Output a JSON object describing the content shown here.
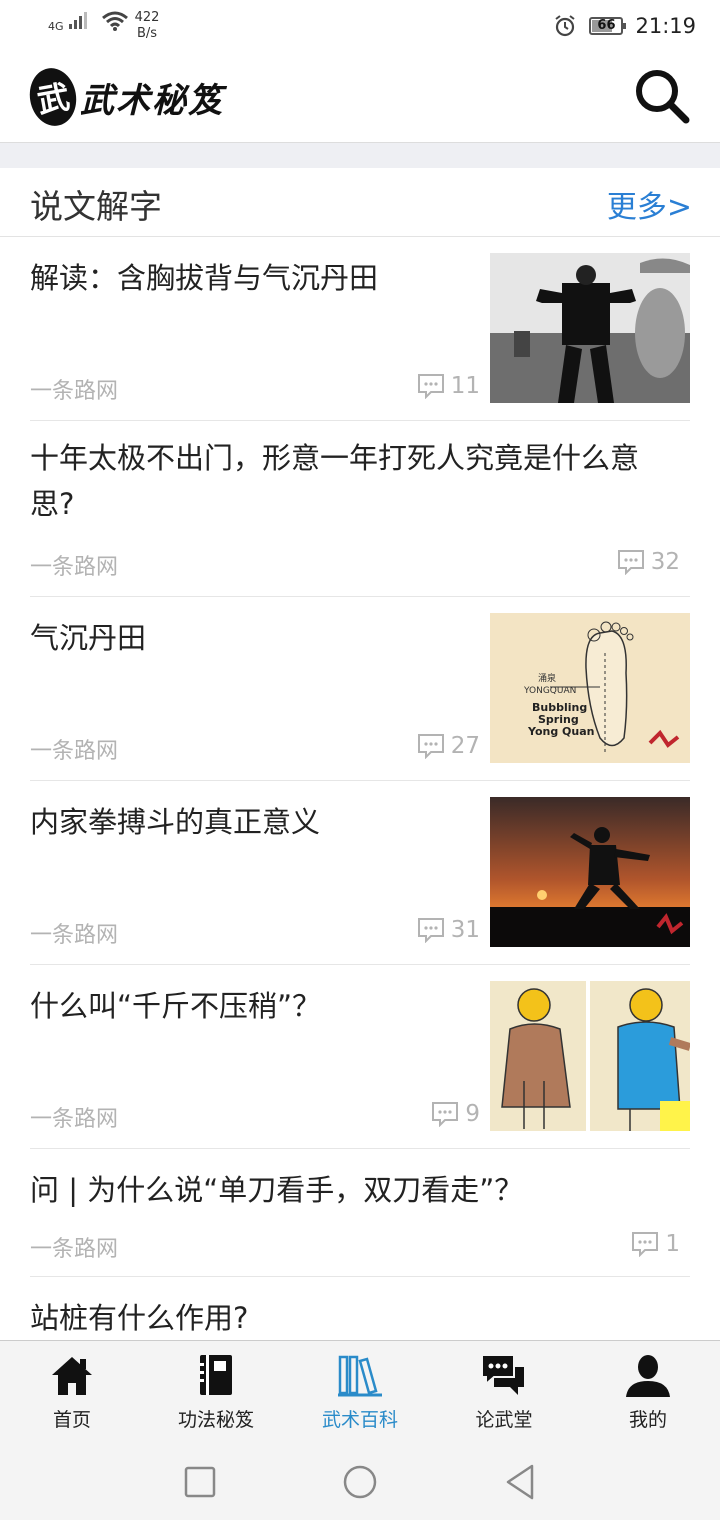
{
  "status": {
    "network": "4G",
    "speed_value": "422",
    "speed_unit": "B/s",
    "battery": "66",
    "time": "21:19"
  },
  "app": {
    "seal_char": "武",
    "title": "武术秘笈"
  },
  "section": {
    "title": "说文解字",
    "more": "更多>"
  },
  "articles": [
    {
      "title": "解读：含胸拔背与气沉丹田",
      "source": "一条路网",
      "comments": "11"
    },
    {
      "title": "十年太极不出门，形意一年打死人究竟是什么意思?",
      "source": "一条路网",
      "comments": "32"
    },
    {
      "title": "气沉丹田",
      "source": "一条路网",
      "comments": "27",
      "thumb_text": [
        "涌泉",
        "YONGQUAN",
        "Bubbling",
        "Spring",
        "Yong Quan"
      ]
    },
    {
      "title": "内家拳搏斗的真正意义",
      "source": "一条路网",
      "comments": "31"
    },
    {
      "title": "什么叫“千斤不压稍”？",
      "source": "一条路网",
      "comments": "9"
    },
    {
      "title": "问 | 为什么说“单刀看手，双刀看走”？",
      "source": "一条路网",
      "comments": "1"
    },
    {
      "title": "站桩有什么作用?"
    }
  ],
  "tabs": [
    {
      "label": "首页",
      "icon": "home-icon"
    },
    {
      "label": "功法秘笈",
      "icon": "book-icon"
    },
    {
      "label": "武术百科",
      "icon": "library-icon",
      "active": true
    },
    {
      "label": "论武堂",
      "icon": "chat-icon"
    },
    {
      "label": "我的",
      "icon": "user-icon"
    }
  ],
  "colors": {
    "accent": "#2a8bc9",
    "more_link": "#2a7fd4",
    "muted": "#b3b3b3"
  }
}
